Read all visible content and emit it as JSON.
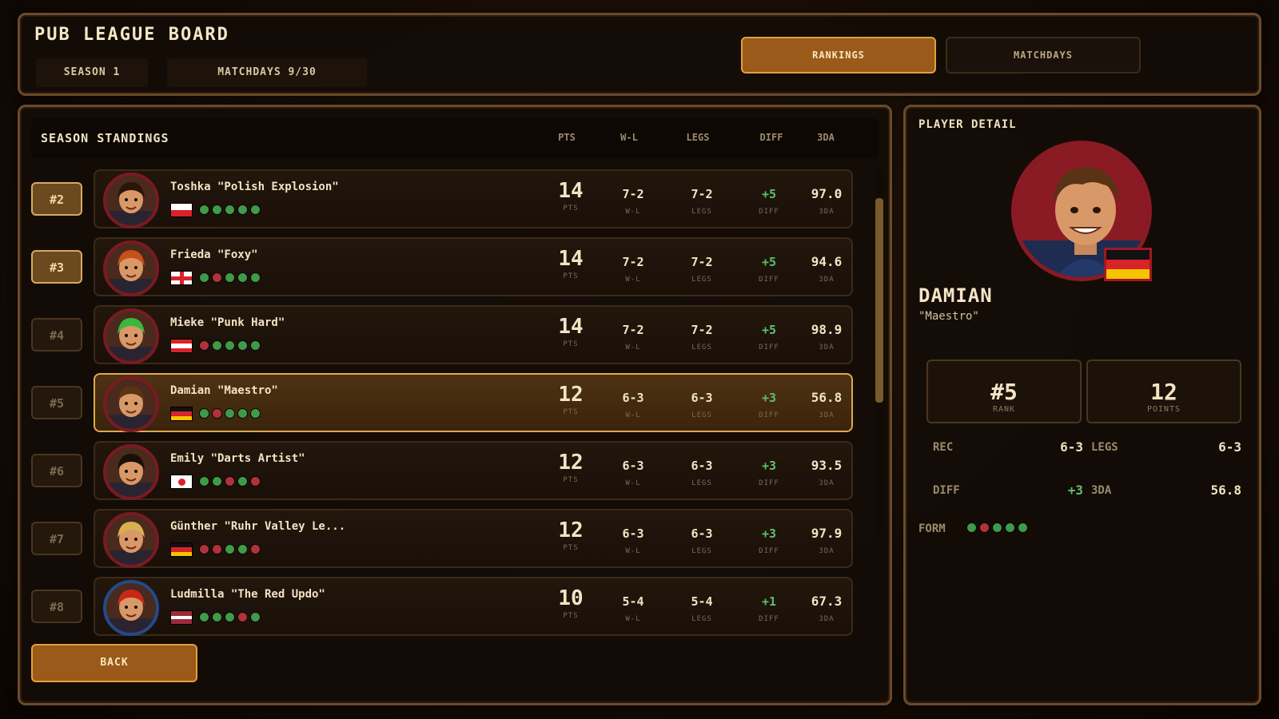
{
  "header": {
    "title": "PUB LEAGUE BOARD",
    "season": "SEASON 1",
    "matchdays": "MATCHDAYS 9/30",
    "tabs": [
      {
        "label": "RANKINGS",
        "active": true
      },
      {
        "label": "MATCHDAYS",
        "active": false
      }
    ]
  },
  "standings": {
    "title": "SEASON STANDINGS",
    "columns": [
      "PTS",
      "W-L",
      "LEGS",
      "DIFF",
      "3DA"
    ],
    "unit_labels": {
      "pts": "PTS",
      "wl": "W-L",
      "legs": "LEGS",
      "diff": "DIFF",
      "avg": "3DA"
    },
    "rows": [
      {
        "rank": "#2",
        "name": "Toshka \"Polish Explosion\"",
        "flag": "poland-flag",
        "form": [
          "w",
          "w",
          "w",
          "w",
          "w"
        ],
        "pts": "14",
        "wl": "7-2",
        "legs": "7-2",
        "diff": "+5",
        "avg": "97.0",
        "highlight": true,
        "selected": false
      },
      {
        "rank": "#3",
        "name": "Frieda \"Foxy\"",
        "flag": "england-flag",
        "form": [
          "w",
          "l",
          "w",
          "w",
          "w"
        ],
        "pts": "14",
        "wl": "7-2",
        "legs": "7-2",
        "diff": "+5",
        "avg": "94.6",
        "highlight": true,
        "selected": false
      },
      {
        "rank": "#4",
        "name": "Mieke \"Punk Hard\"",
        "flag": "austria-flag",
        "form": [
          "l",
          "w",
          "w",
          "w",
          "w"
        ],
        "pts": "14",
        "wl": "7-2",
        "legs": "7-2",
        "diff": "+5",
        "avg": "98.9",
        "highlight": false,
        "selected": false
      },
      {
        "rank": "#5",
        "name": "Damian \"Maestro\"",
        "flag": "germany-flag",
        "form": [
          "w",
          "l",
          "w",
          "w",
          "w"
        ],
        "pts": "12",
        "wl": "6-3",
        "legs": "6-3",
        "diff": "+3",
        "avg": "56.8",
        "highlight": false,
        "selected": true
      },
      {
        "rank": "#6",
        "name": "Emily \"Darts Artist\"",
        "flag": "japan-flag",
        "form": [
          "w",
          "w",
          "l",
          "w",
          "l"
        ],
        "pts": "12",
        "wl": "6-3",
        "legs": "6-3",
        "diff": "+3",
        "avg": "93.5",
        "highlight": false,
        "selected": false
      },
      {
        "rank": "#7",
        "name": "Günther \"Ruhr Valley Le...",
        "flag": "germany-flag",
        "form": [
          "l",
          "l",
          "w",
          "w",
          "l"
        ],
        "pts": "12",
        "wl": "6-3",
        "legs": "6-3",
        "diff": "+3",
        "avg": "97.9",
        "highlight": false,
        "selected": false
      },
      {
        "rank": "#8",
        "name": "Ludmilla \"The Red Updo\"",
        "flag": "latvia-flag",
        "form": [
          "w",
          "w",
          "w",
          "l",
          "w"
        ],
        "pts": "10",
        "wl": "5-4",
        "legs": "5-4",
        "diff": "+1",
        "avg": "67.3",
        "highlight": false,
        "selected": false
      }
    ],
    "back_label": "BACK"
  },
  "detail": {
    "title": "PLAYER DETAIL",
    "name": "DAMIAN",
    "nickname": "\"Maestro\"",
    "flag": "germany-flag",
    "rank_value": "#5",
    "rank_label": "RANK",
    "points_value": "12",
    "points_label": "POINTS",
    "rec_label": "REC",
    "rec_value": "6-3",
    "legs_label": "LEGS",
    "legs_value": "6-3",
    "diff_label": "DIFF",
    "diff_value": "+3",
    "avg_label": "3DA",
    "avg_value": "56.8",
    "form_label": "FORM",
    "form": [
      "w",
      "l",
      "w",
      "w",
      "w"
    ]
  },
  "colors": {
    "accent": "#9a5a1a",
    "accent_border": "#e0a040",
    "win": "#3f9a4a",
    "loss": "#b0323a",
    "diff_positive": "#5fc06a"
  }
}
